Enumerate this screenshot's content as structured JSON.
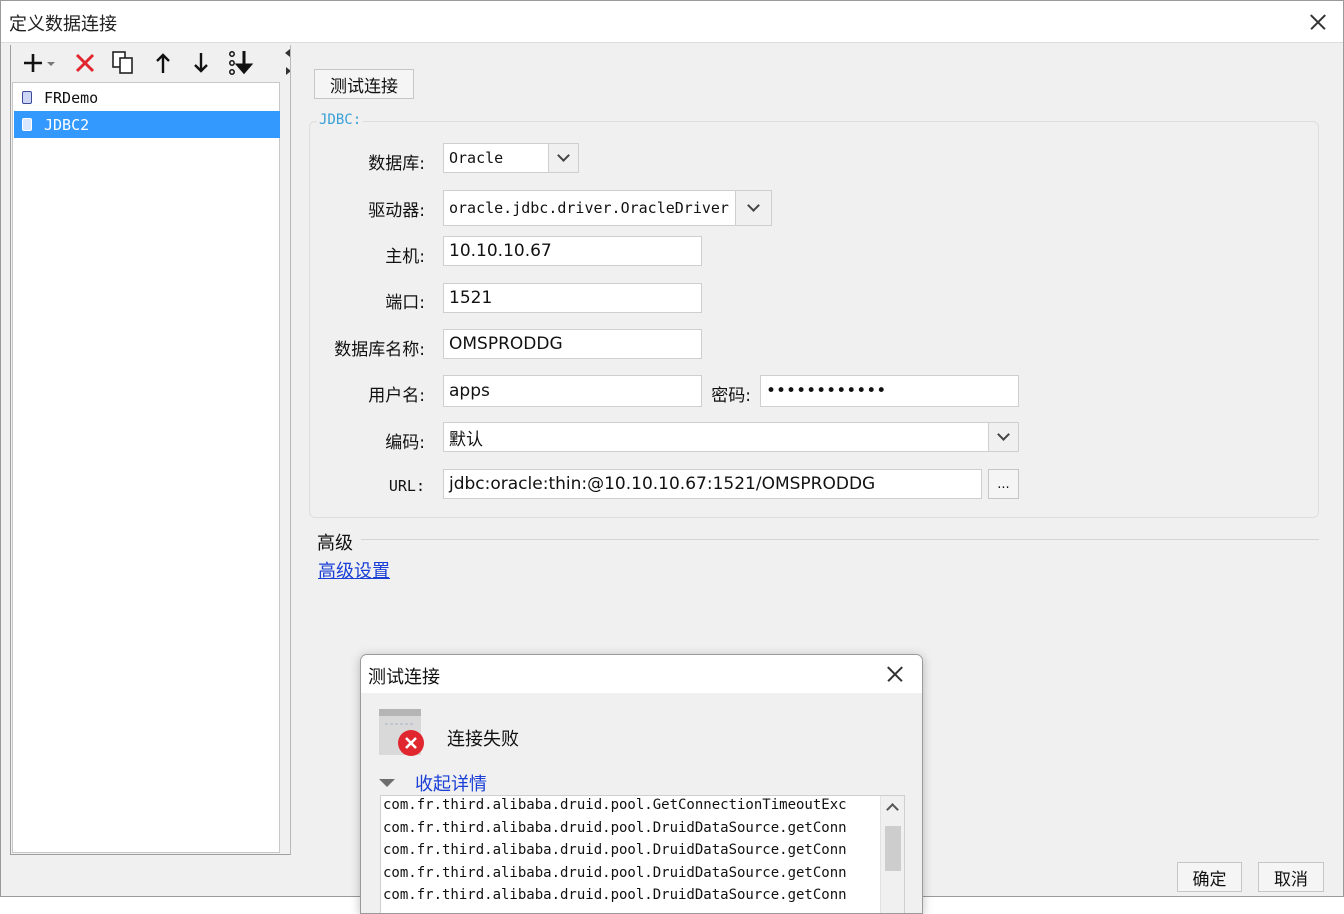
{
  "window": {
    "title": "定义数据连接"
  },
  "toolbar": {
    "icons": [
      "add-icon",
      "delete-icon",
      "copy-icon",
      "move-up-icon",
      "move-down-icon",
      "sort-icon"
    ]
  },
  "connections": {
    "items": [
      {
        "label": "FRDemo",
        "selected": false
      },
      {
        "label": "JDBC2",
        "selected": true
      }
    ]
  },
  "form": {
    "test_button": "测试连接",
    "group_title": "JDBC:",
    "database_label": "数据库:",
    "database_value": "Oracle",
    "driver_label": "驱动器:",
    "driver_value": "oracle.jdbc.driver.OracleDriver",
    "host_label": "主机:",
    "host_value": "10.10.10.67",
    "port_label": "端口:",
    "port_value": "1521",
    "dbname_label": "数据库名称:",
    "dbname_value": "OMSPRODDG",
    "user_label": "用户名:",
    "user_value": "apps",
    "password_label": "密码:",
    "password_value": "••••••••••••",
    "encoding_label": "编码:",
    "encoding_value": "默认",
    "url_label": "URL:",
    "url_value": "jdbc:oracle:thin:@10.10.10.67:1521/OMSPRODDG",
    "url_more": "..."
  },
  "advanced": {
    "title": "高级",
    "link": "高级设置"
  },
  "footer": {
    "ok": "确定",
    "cancel": "取消"
  },
  "dialog": {
    "title": "测试连接",
    "status": "连接失败",
    "toggle": "收起详情",
    "lines": [
      "com.fr.third.alibaba.druid.pool.GetConnectionTimeoutExc",
      "com.fr.third.alibaba.druid.pool.DruidDataSource.getConn",
      "com.fr.third.alibaba.druid.pool.DruidDataSource.getConn",
      "com.fr.third.alibaba.druid.pool.DruidDataSource.getConn",
      "com.fr.third.alibaba.druid.pool.DruidDataSource.getConn"
    ]
  },
  "colors": {
    "selection": "#3399ff",
    "link": "#1a3fd6",
    "group_title": "#3aa0d8",
    "error": "#e0272f"
  }
}
